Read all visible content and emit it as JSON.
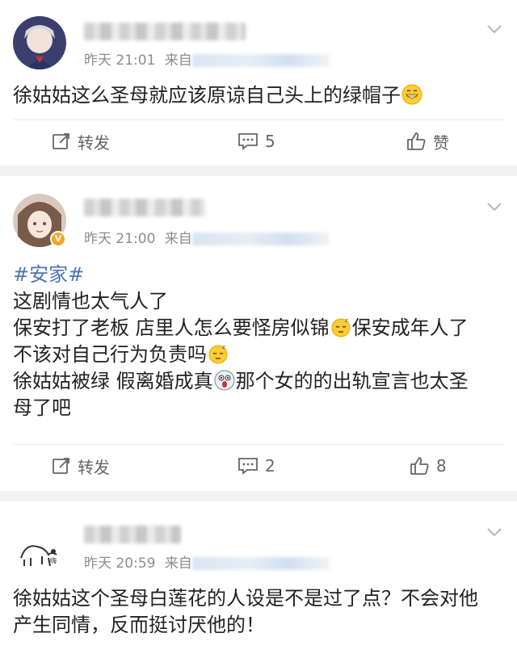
{
  "posts": [
    {
      "time": "昨天 21:01",
      "source_prefix": "来自",
      "content": "徐姑姑这么圣母就应该原谅自己头上的绿帽子",
      "actions": {
        "repost": "转发",
        "comments": "5",
        "like": "赞"
      }
    },
    {
      "time": "昨天 21:00",
      "source_prefix": "来自",
      "hashtag": "#安家#",
      "lines": [
        "这剧情也太气人了",
        "保安打了老板 店里人怎么要怪房似锦",
        "保安成年人了",
        "不该对自己行为负责吗",
        "徐姑姑被绿 假离婚成真",
        "那个女的的出轨宣言也太圣",
        "母了吧"
      ],
      "actions": {
        "repost": "转发",
        "comments": "2",
        "like": "8"
      }
    },
    {
      "time": "昨天 20:59",
      "source_prefix": "来自",
      "lines": [
        "徐姑姑这个圣母白莲花的人设是不是过了点？不会对他",
        "产生同情，反而挺讨厌他的！"
      ]
    }
  ],
  "colors": {
    "hashtag": "#4a76b4",
    "meta": "#8d8d8d",
    "separator": "#f2f2f2",
    "verified_badge": "#f5a623"
  },
  "icons": [
    "chevron-down-icon",
    "repost-icon",
    "comment-icon",
    "like-icon",
    "grin-emoji",
    "sleepy-emoji",
    "shocked-emoji"
  ]
}
